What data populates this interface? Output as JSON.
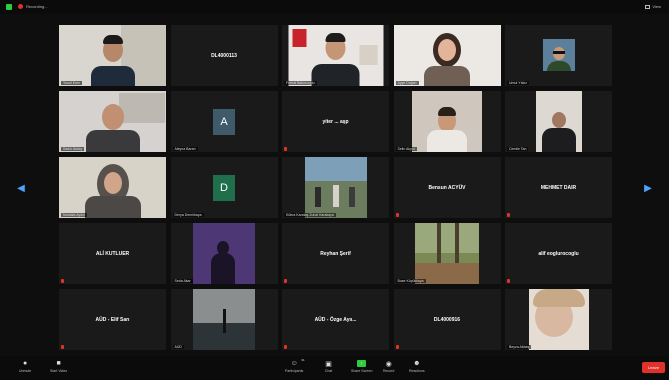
{
  "topbar": {
    "recording_label": "Recording...",
    "view_label": "View"
  },
  "colors": {
    "active_speaker": "#8bc34a",
    "record": "#e0312b",
    "share": "#2ecc40",
    "nav_arrow": "#4aa3ff",
    "avatar_a": "#3e5a6b",
    "avatar_d": "#1f6f4c"
  },
  "tiles": [
    {
      "name": "Yusuf Eren"
    },
    {
      "name": "DL4000113"
    },
    {
      "name": "Ferhat Bakırcıoğlu"
    },
    {
      "name": "Ayşe Doğan"
    },
    {
      "name": "Umut Yıldız"
    },
    {
      "name": "Sadık Atalay"
    },
    {
      "name": "Aleyna Baran",
      "avatar": "A"
    },
    {
      "name": "yiter ... aşp"
    },
    {
      "name": "Selin Akyol"
    },
    {
      "name": "Cemile Tan"
    },
    {
      "name": "Mustafa Aydın"
    },
    {
      "name": "Derya Demirkaya",
      "avatar": "D"
    },
    {
      "name": "Kübra Karataş Zuhal Karakaya"
    },
    {
      "name": "Bensun ACYÜV"
    },
    {
      "name": "MEHMET DAIR"
    },
    {
      "name": "ALİ KUTLUER"
    },
    {
      "name": "Seda Akar"
    },
    {
      "name": "Reyhan Şerif"
    },
    {
      "name": "Buse Küçükkaya"
    },
    {
      "name": "alif eoglurocoglu"
    },
    {
      "name": "AÜD - Elif Sarı"
    },
    {
      "name": "AÜD"
    },
    {
      "name": "AÜD - Özge Ayıı..."
    },
    {
      "name": "DL4000916"
    },
    {
      "name": "Beyza Akbaş"
    }
  ],
  "toolbar": {
    "audio": "Unmute",
    "video": "Start Video",
    "participants": "Participants",
    "participants_count": "31",
    "chat": "Chat",
    "share": "Share Screen",
    "record": "Record",
    "reactions": "Reactions",
    "end": "Leave"
  }
}
